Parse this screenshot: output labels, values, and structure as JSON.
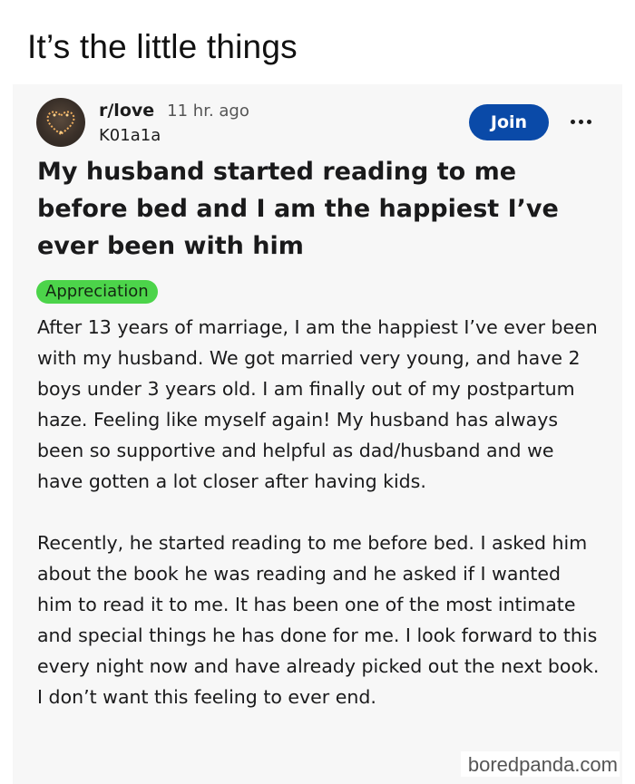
{
  "page": {
    "title": "It’s the little things"
  },
  "post": {
    "subreddit": "r/love",
    "time": "11 hr. ago",
    "username": "K01a1a",
    "join_label": "Join",
    "title": "My husband started reading to me before bed and I am the happiest I’ve ever been with him",
    "flair": "Appreciation",
    "paragraphs": [
      "After 13 years of marriage, I am the happiest I’ve ever been with my husband. We got married very young, and have 2 boys under 3 years old. I am finally out of my postpartum haze. Feeling like myself again! My husband has always been so supportive and helpful as dad/husband and we have gotten a lot closer after having kids.",
      "Recently, he started reading to me before bed. I asked him about the book he was reading and he asked if I wanted him to read it to me. It has been one of the most intimate and special things he has done for me. I look forward to this every night now and have already picked out the next book. I don’t want this feeling to ever end."
    ]
  },
  "watermark": "boredpanda.com",
  "colors": {
    "join_button": "#0a4aa8",
    "flair": "#4cd44a",
    "card_background": "#f7f7f7"
  },
  "icons": {
    "avatar": "heart-lights-avatar",
    "more": "more-options-icon"
  }
}
